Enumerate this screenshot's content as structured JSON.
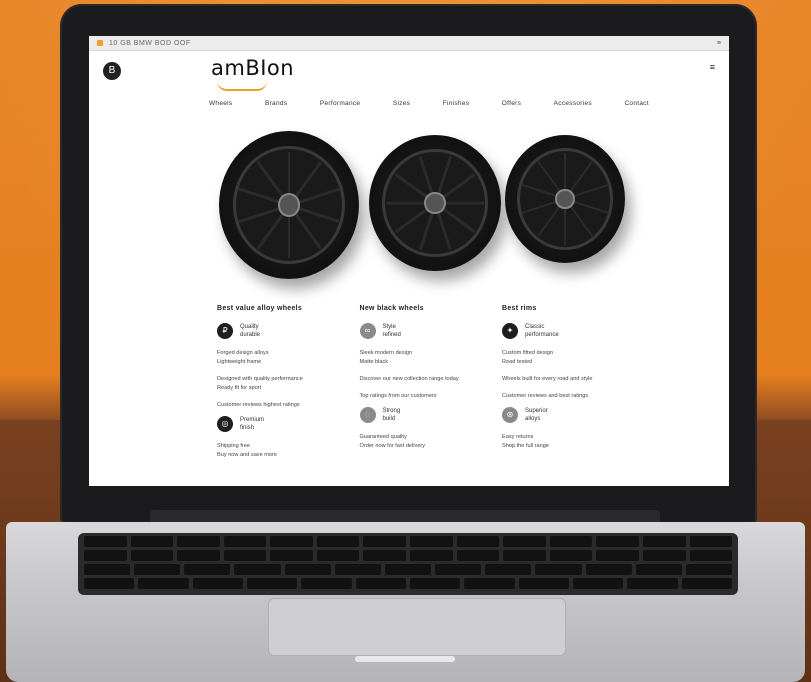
{
  "browser": {
    "url_text": "10 GB   BMW   BOD   OOF",
    "menu_text": "≡"
  },
  "site": {
    "logo": "amBIon",
    "icon": "B",
    "account": "≡"
  },
  "nav": [
    "Wheels",
    "Brands",
    "Performance",
    "Sizes",
    "Finishes",
    "Offers",
    "Accessories",
    "Contact"
  ],
  "columns": [
    {
      "title": "Best value alloy wheels",
      "feature1": {
        "icon": "₽",
        "line1": "Quality",
        "line2": "durable"
      },
      "lines_a": [
        "Forged design alloys",
        "Lightweight frame"
      ],
      "lines_b": [
        "Designed with quality performance",
        "Ready fit for sport"
      ],
      "note": "Customer reviews highest ratings",
      "feature2": {
        "icon": "◎",
        "line1": "Premium",
        "line2": "finish"
      },
      "lines_c": [
        "Shipping free",
        "Buy now and save more"
      ]
    },
    {
      "title": "New black wheels",
      "feature1": {
        "icon": "∞",
        "line1": "Style",
        "line2": "refined"
      },
      "lines_a": [
        "Sleek modern design",
        "Matte black"
      ],
      "lines_b": [
        "Discover our new collection range today"
      ],
      "note": "Top ratings from our customers",
      "feature2": {
        "icon": "◌",
        "line1": "Strong",
        "line2": "build"
      },
      "lines_c": [
        "Guaranteed quality",
        "Order now for fast delivery"
      ]
    },
    {
      "title": "Best rims",
      "feature1": {
        "icon": "✦",
        "line1": "Classic",
        "line2": "performance"
      },
      "lines_a": [
        "Custom fitted design",
        "Road tested"
      ],
      "lines_b": [
        "Wheels built for every road and style"
      ],
      "note": "Customer reviews and best ratings",
      "feature2": {
        "icon": "⊛",
        "line1": "Superior",
        "line2": "alloys"
      },
      "lines_c": [
        "Easy returns",
        "Shop the full range"
      ]
    }
  ],
  "colors": {
    "accent": "#f0a020",
    "brand_text": "#111111",
    "wall": "#e57f1f"
  }
}
